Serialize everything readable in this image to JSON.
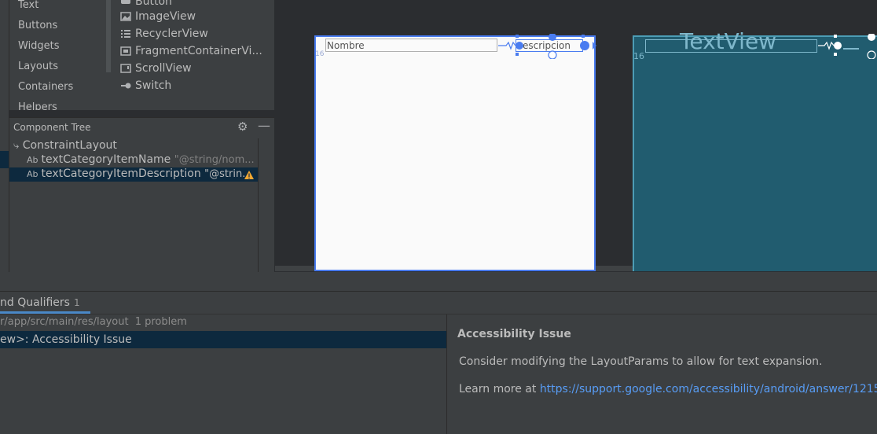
{
  "palette": {
    "categories": [
      "Text",
      "Buttons",
      "Widgets",
      "Layouts",
      "Containers",
      "Helpers"
    ],
    "items": [
      {
        "icon": "button-icon",
        "label": "Button"
      },
      {
        "icon": "image-icon",
        "label": "ImageView"
      },
      {
        "icon": "list-icon",
        "label": "RecyclerView"
      },
      {
        "icon": "fragment-icon",
        "label": "FragmentContainerVi..."
      },
      {
        "icon": "scroll-icon",
        "label": "ScrollView"
      },
      {
        "icon": "switch-icon",
        "label": "Switch"
      }
    ]
  },
  "component_tree": {
    "title": "Component Tree",
    "root": "ConstraintLayout",
    "badge": "Ab",
    "children": [
      {
        "name": "textCategoryItemName",
        "value": "\"@string/nom..."
      },
      {
        "name": "textCategoryItemDescription",
        "value": "\"@strin..."
      }
    ]
  },
  "design": {
    "name_hint": "Nombre",
    "desc_hint": "escripcion",
    "margin": "16",
    "blueprint_text": "TextView",
    "blueprint_margin": "16"
  },
  "problems": {
    "tab_label": "nd Qualifiers",
    "tab_count": "1",
    "path": "r/app/src/main/res/layout",
    "problem_count": "1 problem",
    "issue": "ew>: Accessibility Issue",
    "detail_title": "Accessibility Issue",
    "detail_body": "Consider modifying the LayoutParams to allow for text expansion.",
    "learn_more": "Learn more at ",
    "link": "https://support.google.com/accessibility/android/answer/1215"
  },
  "colors": {
    "selection": "#0d293e",
    "accent": "#4a7cf0",
    "blueprint": "#215c6f",
    "warning": "#f0a732",
    "link": "#589df6"
  }
}
